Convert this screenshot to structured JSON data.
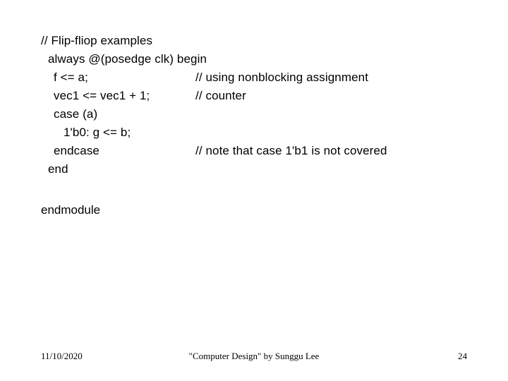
{
  "slide": {
    "background_color": "#ffffff",
    "text_color": "#000000",
    "code": {
      "lines": [
        {
          "text": "// Flip-fliop examples",
          "indent": 0,
          "comment": ""
        },
        {
          "text": "always @(posedge clk) begin",
          "indent": 1,
          "comment": ""
        },
        {
          "text": "f <= a;",
          "indent": 2,
          "comment": "// using nonblocking assignment"
        },
        {
          "text": "vec1 <= vec1 + 1;",
          "indent": 2,
          "comment": "// counter"
        },
        {
          "text": "case (a)",
          "indent": 2,
          "comment": ""
        },
        {
          "text": "1'b0: g <= b;",
          "indent": 3,
          "comment": ""
        },
        {
          "text": "endcase",
          "indent": 2,
          "comment": "// note that case 1'b1 is not covered"
        },
        {
          "text": "end",
          "indent": 1,
          "comment": ""
        }
      ],
      "endmodule": "endmodule"
    },
    "footer": {
      "date": "11/10/2020",
      "center": "\"Computer Design\" by Sunggu Lee",
      "page_number": "24"
    }
  }
}
